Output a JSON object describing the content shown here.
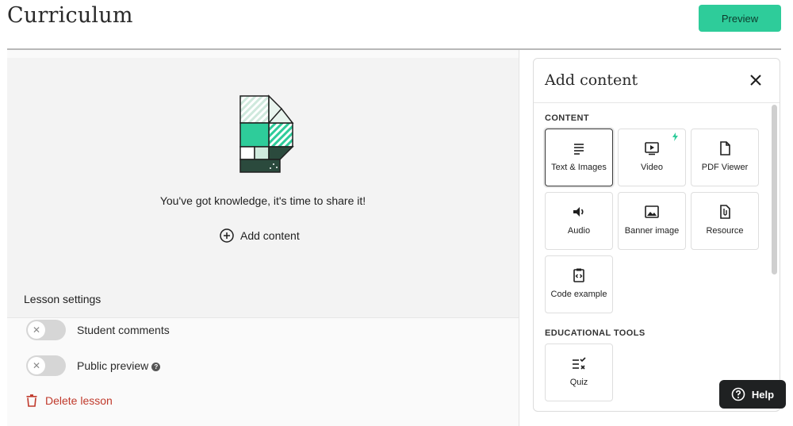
{
  "header": {
    "title": "Curriculum",
    "preview_label": "Preview"
  },
  "hero": {
    "message": "You've got knowledge, it's time to share it!",
    "add_content_label": "Add content"
  },
  "lesson_settings": {
    "title": "Lesson settings",
    "student_comments_label": "Student comments",
    "public_preview_label": "Public preview",
    "delete_label": "Delete lesson"
  },
  "panel": {
    "title": "Add content",
    "content_section": "CONTENT",
    "tiles": [
      {
        "label": "Text & Images",
        "icon": "text-lines-icon"
      },
      {
        "label": "Video",
        "icon": "video-icon"
      },
      {
        "label": "PDF Viewer",
        "icon": "document-icon"
      },
      {
        "label": "Audio",
        "icon": "speaker-icon"
      },
      {
        "label": "Banner image",
        "icon": "image-icon"
      },
      {
        "label": "Resource",
        "icon": "paperclip-file-icon"
      },
      {
        "label": "Code example",
        "icon": "code-clipboard-icon"
      }
    ],
    "edu_section": "EDUCATIONAL TOOLS",
    "edu_tiles": [
      {
        "label": "Quiz",
        "icon": "quiz-icon"
      }
    ]
  },
  "help": {
    "label": "Help"
  },
  "colors": {
    "accent": "#2ecc9a",
    "danger": "#c0392b",
    "help_bg": "#1f2122"
  }
}
